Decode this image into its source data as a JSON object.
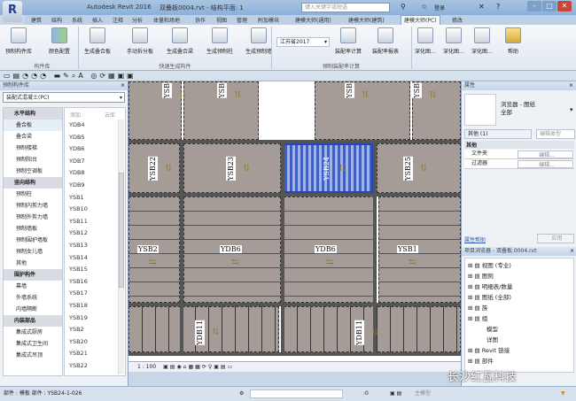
{
  "title": {
    "app": "Autodesk Revit 2016",
    "doc": "双叠板0004.rvt - 结构平面: 1",
    "search_placeholder": "键入关键字或短语",
    "login": "登录"
  },
  "tabs": [
    "建筑",
    "结构",
    "系统",
    "插入",
    "注释",
    "分析",
    "体量和场地",
    "协作",
    "视图",
    "管理",
    "附加模块",
    "建模大师(通用)",
    "建模大师(建筑)",
    "建模大师(PC)",
    "修改"
  ],
  "active_tab": "建模大师(PC)",
  "ribbon": {
    "buttons": [
      "预制构件库",
      "颜色配置",
      "生成叠合板",
      "手动拆分板",
      "生成叠合梁",
      "生成预制柱",
      "生成预制墙",
      "装配率计算",
      "装配率报表",
      "深化图...",
      "深化图...",
      "深化图...",
      "帮助"
    ],
    "province_select": "江苏省2017",
    "groups": [
      "构件库",
      "快速生成构件",
      "预制装配率计算"
    ]
  },
  "left_panel": {
    "title": "预制构件库",
    "type_select": "装配式混凝土(PC)",
    "add_label": "添加",
    "upload_label": "云库",
    "categories": [
      {
        "label": "水平结构",
        "header": true
      },
      {
        "label": "叠合板",
        "selected": true
      },
      {
        "label": "叠合梁"
      },
      {
        "label": "预制楼梯"
      },
      {
        "label": "预制阳台"
      },
      {
        "label": "预制空调板"
      },
      {
        "label": "竖向结构",
        "header": true
      },
      {
        "label": "预制柱"
      },
      {
        "label": "预制内剪力墙"
      },
      {
        "label": "预制外剪力墙"
      },
      {
        "label": "预制墙板"
      },
      {
        "label": "预制围护墙板"
      },
      {
        "label": "预制女儿墙"
      },
      {
        "label": "其他"
      },
      {
        "label": "围护构件",
        "header": true
      },
      {
        "label": "幕墙"
      },
      {
        "label": "外墙系统"
      },
      {
        "label": "内墙隔断"
      },
      {
        "label": "内装部品",
        "header": true
      },
      {
        "label": "集成式厨房"
      },
      {
        "label": "集成式卫生间"
      },
      {
        "label": "集成式吊顶"
      }
    ],
    "items": [
      "YDB4",
      "YDB5",
      "YDB6",
      "YDB7",
      "YDB8",
      "YDB9",
      "YSB1",
      "YSB10",
      "YSB11",
      "YSB12",
      "YSB13",
      "YSB14",
      "YSB15",
      "YSB16",
      "YSB17",
      "YSB18",
      "YSB19",
      "YSB2",
      "YSB20",
      "YSB21",
      "YSB22"
    ]
  },
  "drawing": {
    "labels": [
      "YSB",
      "YSB",
      "YSB",
      "YSB",
      "YSB22",
      "YSB23",
      "YSB24",
      "YSB25",
      "YSB2",
      "YDB6",
      "YDB6",
      "YSB1",
      "YDB11",
      "YDB11"
    ],
    "selected_color": "#3a5fd0",
    "slab_color": "#a59c98"
  },
  "view_bar": {
    "scale": "1 : 100"
  },
  "properties": {
    "title": "属性",
    "type": "浏览器 - 图纸",
    "type2": "全部",
    "filter": "其他 (1)",
    "edit_type": "编辑类型",
    "section": "其他",
    "rows": [
      {
        "name": "文件夹",
        "value": "编辑..."
      },
      {
        "name": "过滤器",
        "value": "编辑..."
      }
    ],
    "help": "属性帮助",
    "apply": "应用"
  },
  "project_browser": {
    "title": "项目浏览器 - 双叠板.0004.rvt",
    "nodes": [
      {
        "label": "视图 (专业)"
      },
      {
        "label": "图例"
      },
      {
        "label": "明细表/数量"
      },
      {
        "label": "图纸 (全部)"
      },
      {
        "label": "族"
      },
      {
        "label": "组"
      },
      {
        "label": "模型",
        "child": true
      },
      {
        "label": "详图",
        "child": true
      },
      {
        "label": "Revit 链接"
      },
      {
        "label": "部件"
      }
    ]
  },
  "status": {
    "text": "部件 : 模板 部件 : YSB24-1-026",
    "zero": ":0",
    "model": "主模型"
  },
  "watermark": "长沙红瓦科技"
}
